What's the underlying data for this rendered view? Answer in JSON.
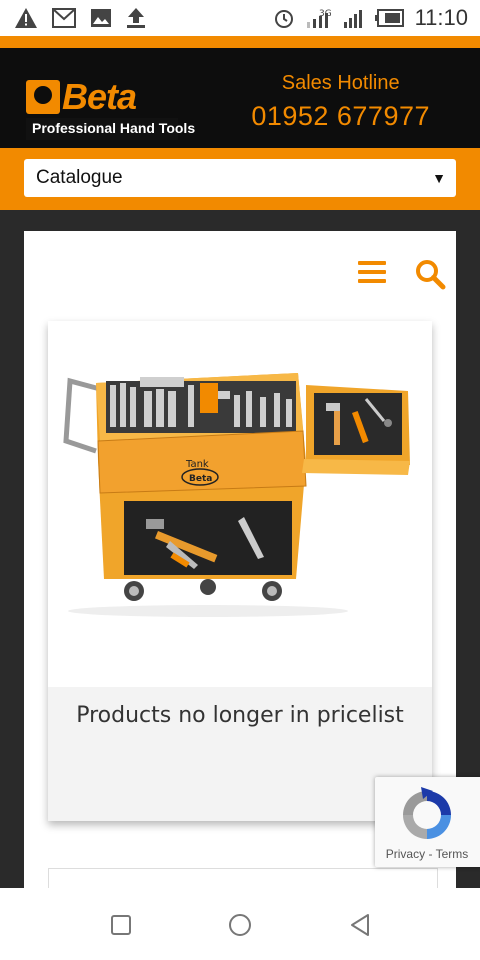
{
  "status_bar": {
    "time": "11:10",
    "network": "3G",
    "icons": [
      "warning-icon",
      "gmail-icon",
      "gallery-icon",
      "upload-icon",
      "alarm-icon",
      "data-arrows-icon",
      "signal-icon",
      "signal-icon",
      "battery-icon"
    ]
  },
  "header": {
    "logo_word": "Beta",
    "logo_tagline": "Professional Hand Tools",
    "hotline_label": "Sales Hotline",
    "hotline_number": "01952 677977"
  },
  "catalogue_select": {
    "value": "Catalogue"
  },
  "nav": {
    "icons": [
      "hamburger-menu-icon",
      "search-icon"
    ]
  },
  "product_card": {
    "image_label": "Tank Beta",
    "caption": "Products no longer in pricelist"
  },
  "recaptcha": {
    "privacy": "Privacy",
    "separator": " - ",
    "terms": "Terms"
  },
  "system_nav": {
    "icons": [
      "square-recents-icon",
      "circle-home-icon",
      "triangle-back-icon"
    ]
  },
  "colors": {
    "accent": "#f28a00",
    "header_bg": "#0d0d0d",
    "frame_bg": "#2a2a2a"
  }
}
